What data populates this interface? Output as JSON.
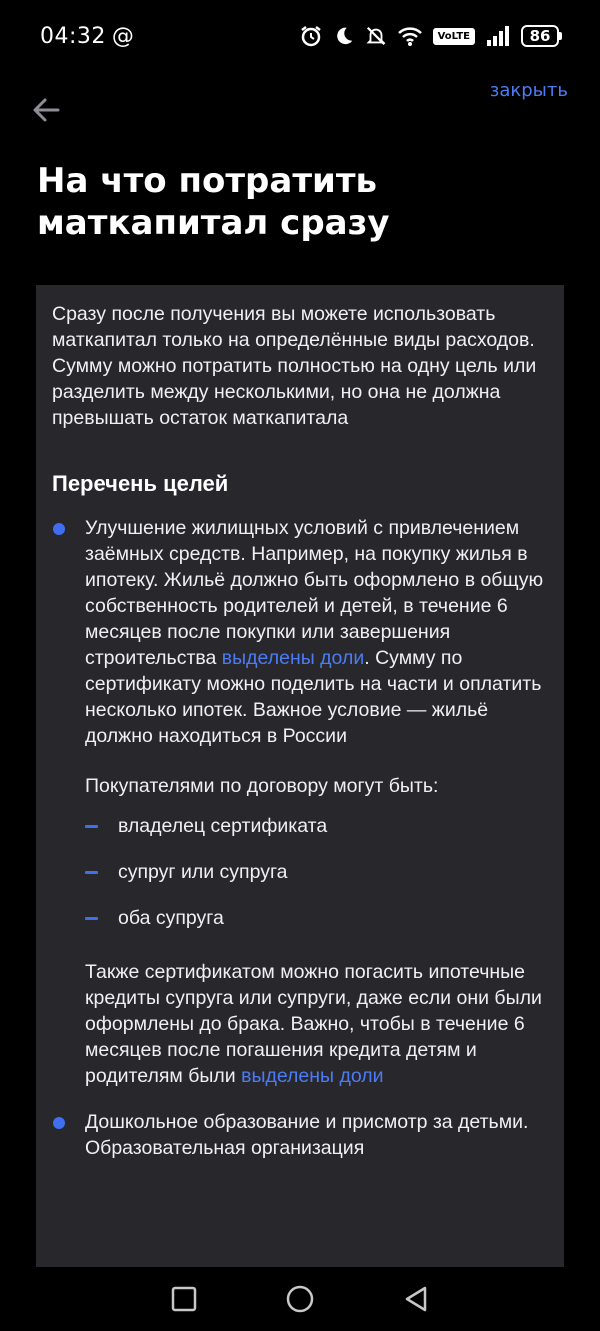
{
  "status_bar": {
    "time": "04:32",
    "at_symbol": "@",
    "network_badge": "VoLTE",
    "battery": "86"
  },
  "nav": {
    "close_label": "закрыть"
  },
  "page": {
    "title": "На что потратить маткапитал сразу"
  },
  "content": {
    "intro": "Сразу после получения вы можете использовать маткапитал только на определённые виды расходов. Сумму можно потратить полностью на одну цель или разделить между несколькими, но она не должна превышать остаток маткапитала",
    "section_title": "Перечень целей",
    "goals": [
      {
        "text_before_link": "Улучшение жилищных условий с привлечением заёмных средств. Например, на покупку жилья в ипотеку. Жильё должно быть оформлено в общую собственность родителей и детей, в течение 6 месяцев после покупки или завершения строительства ",
        "link": "выделены доли",
        "text_after_link": ". Сумму по сертификату можно поделить на части и оплатить несколько ипотек. Важное условие — жильё должно находиться в России",
        "buyers_intro": "Покупателями по договору могут быть:",
        "buyers": [
          "владелец сертификата",
          "супруг или супруга",
          "оба супруга"
        ],
        "extra_before_link": "Также сертификатом можно погасить ипотечные кредиты супруга или супруги, даже если они были оформлены до брака. Важно, чтобы в течение 6 месяцев после погашения кредита детям и родителям были ",
        "extra_link": "выделены доли"
      },
      {
        "text": "Дошкольное образование и присмотр за детьми. Образовательная организация"
      }
    ]
  },
  "colors": {
    "accent": "#4c7cf3",
    "bullet": "#3f6ff0",
    "card_bg": "#27272c",
    "page_bg": "#000000"
  },
  "icons": {
    "back": "arrow-left-icon",
    "alarm": "alarm-icon",
    "moon": "moon-icon",
    "mute": "bell-off-icon",
    "wifi": "wifi-icon",
    "signal": "signal-icon",
    "nav_recent": "square-icon",
    "nav_home": "circle-icon",
    "nav_back": "triangle-back-icon"
  }
}
